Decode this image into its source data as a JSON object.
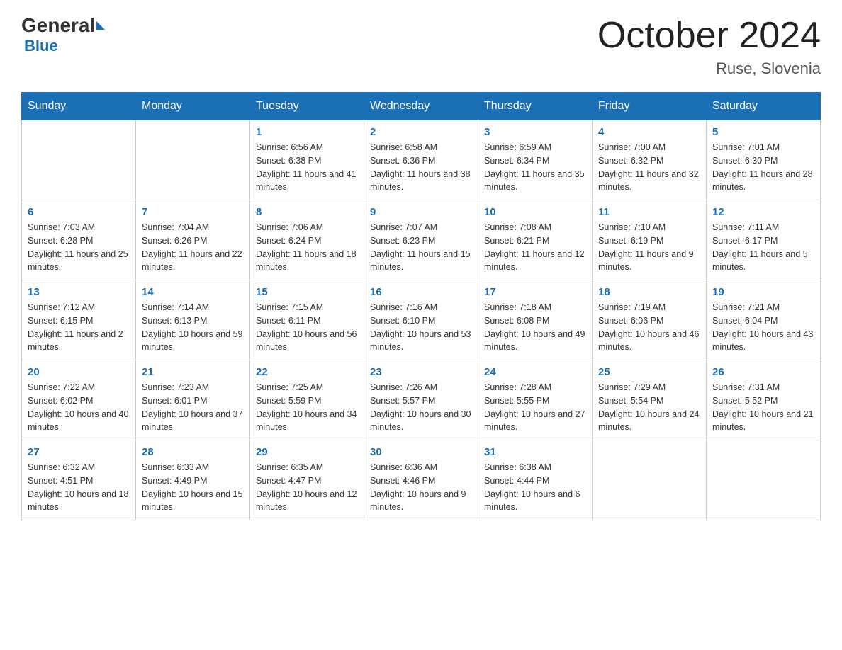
{
  "header": {
    "logo": {
      "general": "General",
      "triangle": "▶",
      "blue": "Blue"
    },
    "title": "October 2024",
    "location": "Ruse, Slovenia"
  },
  "days_of_week": [
    "Sunday",
    "Monday",
    "Tuesday",
    "Wednesday",
    "Thursday",
    "Friday",
    "Saturday"
  ],
  "weeks": [
    [
      {
        "day": "",
        "sunrise": "",
        "sunset": "",
        "daylight": ""
      },
      {
        "day": "",
        "sunrise": "",
        "sunset": "",
        "daylight": ""
      },
      {
        "day": "1",
        "sunrise": "Sunrise: 6:56 AM",
        "sunset": "Sunset: 6:38 PM",
        "daylight": "Daylight: 11 hours and 41 minutes."
      },
      {
        "day": "2",
        "sunrise": "Sunrise: 6:58 AM",
        "sunset": "Sunset: 6:36 PM",
        "daylight": "Daylight: 11 hours and 38 minutes."
      },
      {
        "day": "3",
        "sunrise": "Sunrise: 6:59 AM",
        "sunset": "Sunset: 6:34 PM",
        "daylight": "Daylight: 11 hours and 35 minutes."
      },
      {
        "day": "4",
        "sunrise": "Sunrise: 7:00 AM",
        "sunset": "Sunset: 6:32 PM",
        "daylight": "Daylight: 11 hours and 32 minutes."
      },
      {
        "day": "5",
        "sunrise": "Sunrise: 7:01 AM",
        "sunset": "Sunset: 6:30 PM",
        "daylight": "Daylight: 11 hours and 28 minutes."
      }
    ],
    [
      {
        "day": "6",
        "sunrise": "Sunrise: 7:03 AM",
        "sunset": "Sunset: 6:28 PM",
        "daylight": "Daylight: 11 hours and 25 minutes."
      },
      {
        "day": "7",
        "sunrise": "Sunrise: 7:04 AM",
        "sunset": "Sunset: 6:26 PM",
        "daylight": "Daylight: 11 hours and 22 minutes."
      },
      {
        "day": "8",
        "sunrise": "Sunrise: 7:06 AM",
        "sunset": "Sunset: 6:24 PM",
        "daylight": "Daylight: 11 hours and 18 minutes."
      },
      {
        "day": "9",
        "sunrise": "Sunrise: 7:07 AM",
        "sunset": "Sunset: 6:23 PM",
        "daylight": "Daylight: 11 hours and 15 minutes."
      },
      {
        "day": "10",
        "sunrise": "Sunrise: 7:08 AM",
        "sunset": "Sunset: 6:21 PM",
        "daylight": "Daylight: 11 hours and 12 minutes."
      },
      {
        "day": "11",
        "sunrise": "Sunrise: 7:10 AM",
        "sunset": "Sunset: 6:19 PM",
        "daylight": "Daylight: 11 hours and 9 minutes."
      },
      {
        "day": "12",
        "sunrise": "Sunrise: 7:11 AM",
        "sunset": "Sunset: 6:17 PM",
        "daylight": "Daylight: 11 hours and 5 minutes."
      }
    ],
    [
      {
        "day": "13",
        "sunrise": "Sunrise: 7:12 AM",
        "sunset": "Sunset: 6:15 PM",
        "daylight": "Daylight: 11 hours and 2 minutes."
      },
      {
        "day": "14",
        "sunrise": "Sunrise: 7:14 AM",
        "sunset": "Sunset: 6:13 PM",
        "daylight": "Daylight: 10 hours and 59 minutes."
      },
      {
        "day": "15",
        "sunrise": "Sunrise: 7:15 AM",
        "sunset": "Sunset: 6:11 PM",
        "daylight": "Daylight: 10 hours and 56 minutes."
      },
      {
        "day": "16",
        "sunrise": "Sunrise: 7:16 AM",
        "sunset": "Sunset: 6:10 PM",
        "daylight": "Daylight: 10 hours and 53 minutes."
      },
      {
        "day": "17",
        "sunrise": "Sunrise: 7:18 AM",
        "sunset": "Sunset: 6:08 PM",
        "daylight": "Daylight: 10 hours and 49 minutes."
      },
      {
        "day": "18",
        "sunrise": "Sunrise: 7:19 AM",
        "sunset": "Sunset: 6:06 PM",
        "daylight": "Daylight: 10 hours and 46 minutes."
      },
      {
        "day": "19",
        "sunrise": "Sunrise: 7:21 AM",
        "sunset": "Sunset: 6:04 PM",
        "daylight": "Daylight: 10 hours and 43 minutes."
      }
    ],
    [
      {
        "day": "20",
        "sunrise": "Sunrise: 7:22 AM",
        "sunset": "Sunset: 6:02 PM",
        "daylight": "Daylight: 10 hours and 40 minutes."
      },
      {
        "day": "21",
        "sunrise": "Sunrise: 7:23 AM",
        "sunset": "Sunset: 6:01 PM",
        "daylight": "Daylight: 10 hours and 37 minutes."
      },
      {
        "day": "22",
        "sunrise": "Sunrise: 7:25 AM",
        "sunset": "Sunset: 5:59 PM",
        "daylight": "Daylight: 10 hours and 34 minutes."
      },
      {
        "day": "23",
        "sunrise": "Sunrise: 7:26 AM",
        "sunset": "Sunset: 5:57 PM",
        "daylight": "Daylight: 10 hours and 30 minutes."
      },
      {
        "day": "24",
        "sunrise": "Sunrise: 7:28 AM",
        "sunset": "Sunset: 5:55 PM",
        "daylight": "Daylight: 10 hours and 27 minutes."
      },
      {
        "day": "25",
        "sunrise": "Sunrise: 7:29 AM",
        "sunset": "Sunset: 5:54 PM",
        "daylight": "Daylight: 10 hours and 24 minutes."
      },
      {
        "day": "26",
        "sunrise": "Sunrise: 7:31 AM",
        "sunset": "Sunset: 5:52 PM",
        "daylight": "Daylight: 10 hours and 21 minutes."
      }
    ],
    [
      {
        "day": "27",
        "sunrise": "Sunrise: 6:32 AM",
        "sunset": "Sunset: 4:51 PM",
        "daylight": "Daylight: 10 hours and 18 minutes."
      },
      {
        "day": "28",
        "sunrise": "Sunrise: 6:33 AM",
        "sunset": "Sunset: 4:49 PM",
        "daylight": "Daylight: 10 hours and 15 minutes."
      },
      {
        "day": "29",
        "sunrise": "Sunrise: 6:35 AM",
        "sunset": "Sunset: 4:47 PM",
        "daylight": "Daylight: 10 hours and 12 minutes."
      },
      {
        "day": "30",
        "sunrise": "Sunrise: 6:36 AM",
        "sunset": "Sunset: 4:46 PM",
        "daylight": "Daylight: 10 hours and 9 minutes."
      },
      {
        "day": "31",
        "sunrise": "Sunrise: 6:38 AM",
        "sunset": "Sunset: 4:44 PM",
        "daylight": "Daylight: 10 hours and 6 minutes."
      },
      {
        "day": "",
        "sunrise": "",
        "sunset": "",
        "daylight": ""
      },
      {
        "day": "",
        "sunrise": "",
        "sunset": "",
        "daylight": ""
      }
    ]
  ]
}
